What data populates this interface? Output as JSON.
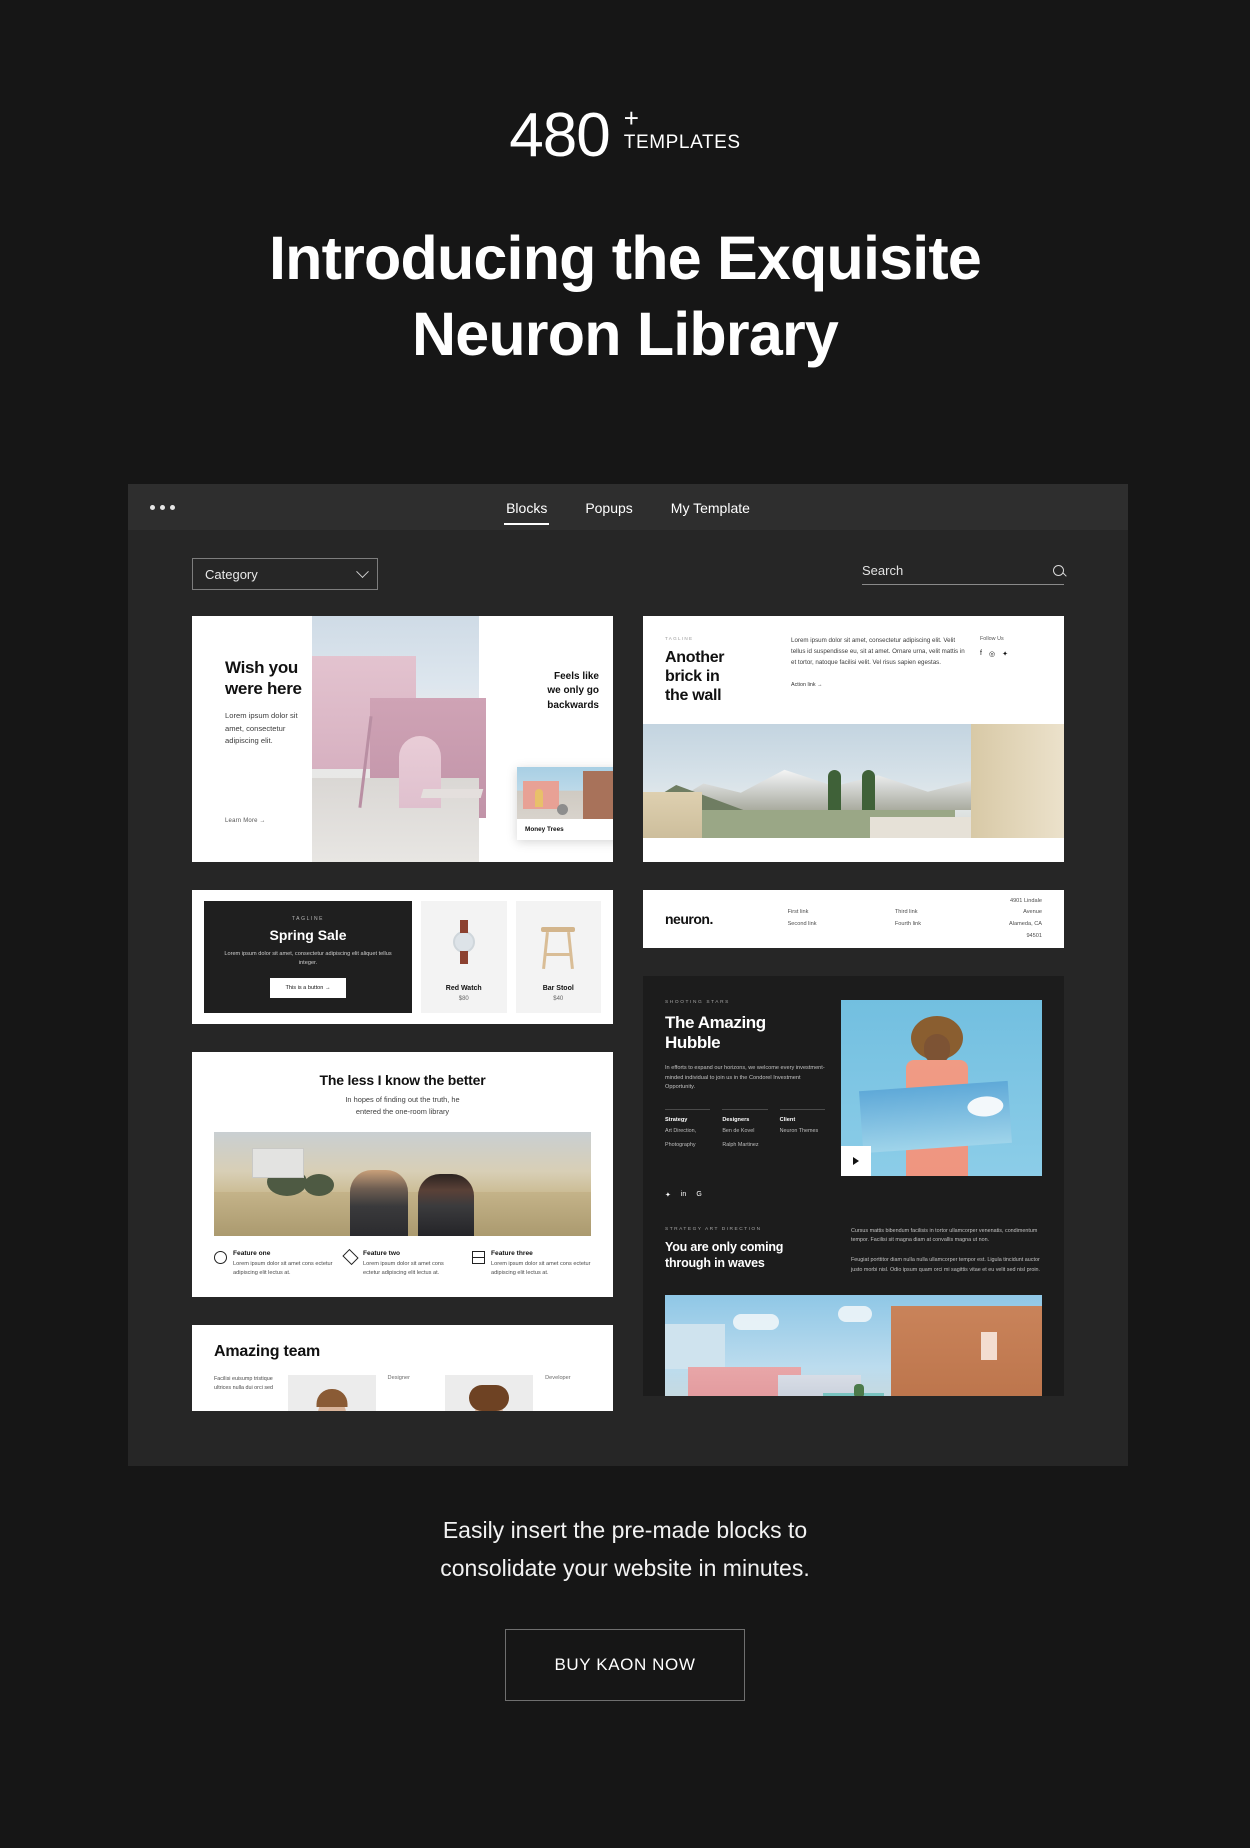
{
  "hero": {
    "count": "480",
    "plus": "+",
    "count_label": "TEMPLATES",
    "title_line1": "Introducing the Exquisite",
    "title_line2": "Neuron Library"
  },
  "app": {
    "tabs": [
      {
        "label": "Blocks",
        "active": true
      },
      {
        "label": "Popups",
        "active": false
      },
      {
        "label": "My Template",
        "active": false
      }
    ],
    "category_select": {
      "value": "Category",
      "icon": "chevron-down-icon"
    },
    "search": {
      "placeholder": "Search",
      "value": "Search",
      "icon": "search-icon"
    }
  },
  "templates": {
    "wish": {
      "title": "Wish you\nwere here",
      "title_l1": "Wish you",
      "title_l2": "were here",
      "body": "Lorem ipsum dolor sit amet, consectetur adipiscing elit.",
      "link": "Learn More  →",
      "side_heading": "Feels like\nwe only go\nbackwards",
      "side_l1": "Feels like",
      "side_l2": "we only go",
      "side_l3": "backwards",
      "thumb_label": "Money Trees",
      "thumb_arrow": "→"
    },
    "brick": {
      "tagline": "TAGLINE",
      "title_l1": "Another",
      "title_l2": "brick in",
      "title_l3": "the wall",
      "body": "Lorem ipsum dolor sit amet, consectetur adipiscing elit. Velit tellus id suspendisse eu, sit at amet. Ornare urna, velit mattis in et tortor, natoque facilisi velit. Vel risus sapien egestas.",
      "action_link": "Action link  →",
      "follow_label": "Follow Us",
      "social": [
        "f",
        "◎",
        "✦"
      ]
    },
    "spring": {
      "tagline": "TAGLINE",
      "title": "Spring Sale",
      "body": "Lorem ipsum dolor sit amet, consectetur adipiscing elit aliquet tellus integer.",
      "button": "This is a button  →",
      "products": [
        {
          "name": "Red Watch",
          "price": "$80"
        },
        {
          "name": "Bar Stool",
          "price": "$40"
        }
      ]
    },
    "neuron": {
      "logo": "neuron.",
      "links_col1": [
        "First link",
        "Second link"
      ],
      "links_col2": [
        "Third link",
        "Fourth link"
      ],
      "address_l1": "4901 Lindale Avenue",
      "address_l2": "Alameda, CA 94501"
    },
    "less": {
      "title": "The less I know the better",
      "sub_l1": "In hopes of finding out the truth, he",
      "sub_l2": "entered the one-room library",
      "features": [
        {
          "icon": "circle-icon",
          "title": "Feature one",
          "body": "Lorem ipsum dolor sit amet cons ectetur adipiscing elit lectus at."
        },
        {
          "icon": "diamond-icon",
          "title": "Feature two",
          "body": "Lorem ipsum dolor sit amet cons ectetur adipiscing elit lectus at."
        },
        {
          "icon": "rows-icon",
          "title": "Feature three",
          "body": "Lorem ipsum dolor sit amet cons ectetur adipiscing elit lectus at."
        }
      ]
    },
    "hubble": {
      "tagline": "SHOOTING STARS",
      "title_l1": "The Amazing",
      "title_l2": "Hubble",
      "body": "In efforts to expand our horizons, we welcome every investment-minded individual to join us in the Condorel Investment Opportunity.",
      "meta": [
        {
          "label": "Strategy",
          "value_l1": "Art Direction,",
          "value_l2": "Photography"
        },
        {
          "label": "Designers",
          "value_l1": "Ben de Kovel",
          "value_l2": "Ralph Martinez"
        },
        {
          "label": "Client",
          "value_l1": "Neuron Themes",
          "value_l2": ""
        }
      ],
      "social": [
        "✦",
        "in",
        "G"
      ],
      "play_icon": "play-icon"
    },
    "waves": {
      "tagline": "STRATEGY  ART DIRECTION",
      "title_l1": "You are only coming",
      "title_l2": "through in waves",
      "para1": "Cursus mattis bibendum facilisis in tortor ullamcorper venenatis, condimentum tempor. Facilisi sit magna diam at convallis magna ut non.",
      "para2": "Feugiat porttitor diam nulla nulla ullamcorper tempor est. Ligula tincidunt auctor justo morbi nisl. Odio ipsum quam orci mi sagittis vitae et eu velit sed nisl proin."
    },
    "team": {
      "title": "Amazing team",
      "bio": "Facilisi euisump tristique ultrices nulla dui orci sed",
      "role1": "Designer",
      "role2": "Developer"
    }
  },
  "cta": {
    "line1": "Easily insert the pre-made blocks to",
    "line2": "consolidate your website in minutes.",
    "button": "BUY KAON NOW"
  }
}
